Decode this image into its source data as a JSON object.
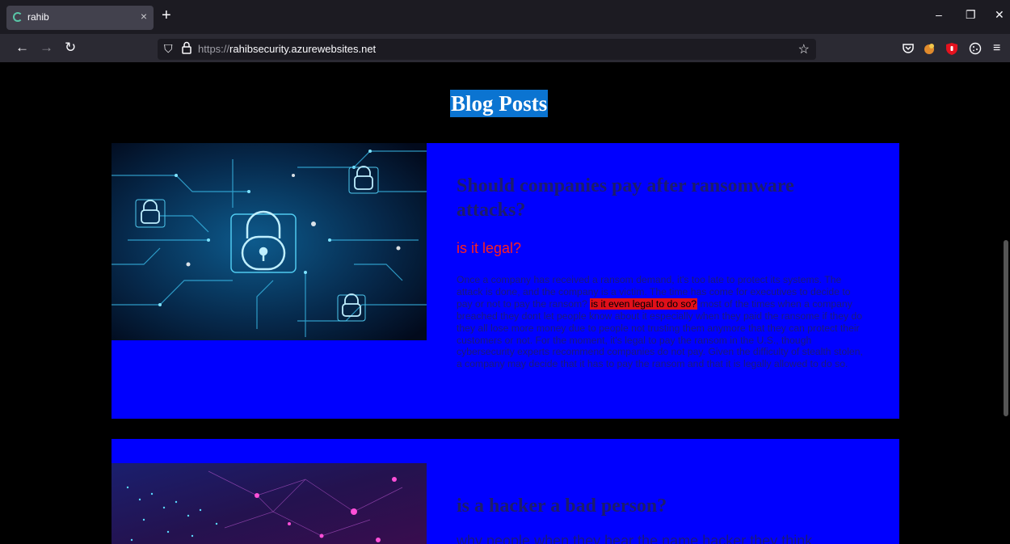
{
  "browser": {
    "tab_title": "rahib",
    "tab_close": "×",
    "new_tab": "+",
    "url_protocol": "https://",
    "url_host": "rahibsecurity.azurewebsites.net",
    "window_controls": {
      "minimize": "–",
      "restore": "❐",
      "close": "✕"
    },
    "nav": {
      "back": "←",
      "forward": "→",
      "reload": "↻"
    },
    "shield": "⛉",
    "star": "☆",
    "menu": "≡",
    "icons": [
      "pocket-icon",
      "extension-icon",
      "ublock-icon",
      "cookie-icon"
    ]
  },
  "page": {
    "heading": "Blog Posts",
    "posts": [
      {
        "title": "Should companies pay after ransomware attacks?",
        "subtitle": "is it legal?",
        "body_before": "Once a company has received a ransom demand, it's too late to protect its systems. The attack is done, and the company is a victim. The time has come for executives to decide to pay or not to pay the ransom?",
        "body_highlight": "is it even legal to do so?",
        "body_after": "most of the times when a company breached they dont let people know about it especially when they paid the ransome if they do they all lose more money due to people not trusting them anymore that they can protect their customers or not. For the moment, it's legal to pay the ransom in the U.S., though cybersecurity experts recommend companies do not pay. Given the difficulty of stealth stolen, a company may decide that it has to pay the ransom and that it is legally allowed to do so."
      },
      {
        "title": "is a hacker a bad person?",
        "body_before": "why people when they hear the name hacker they think"
      }
    ]
  },
  "colors": {
    "post_bg": "#0000ff",
    "heading_bg": "#0b74d1",
    "subtitle": "#ff1f1f",
    "highlight": "#e0101a"
  }
}
